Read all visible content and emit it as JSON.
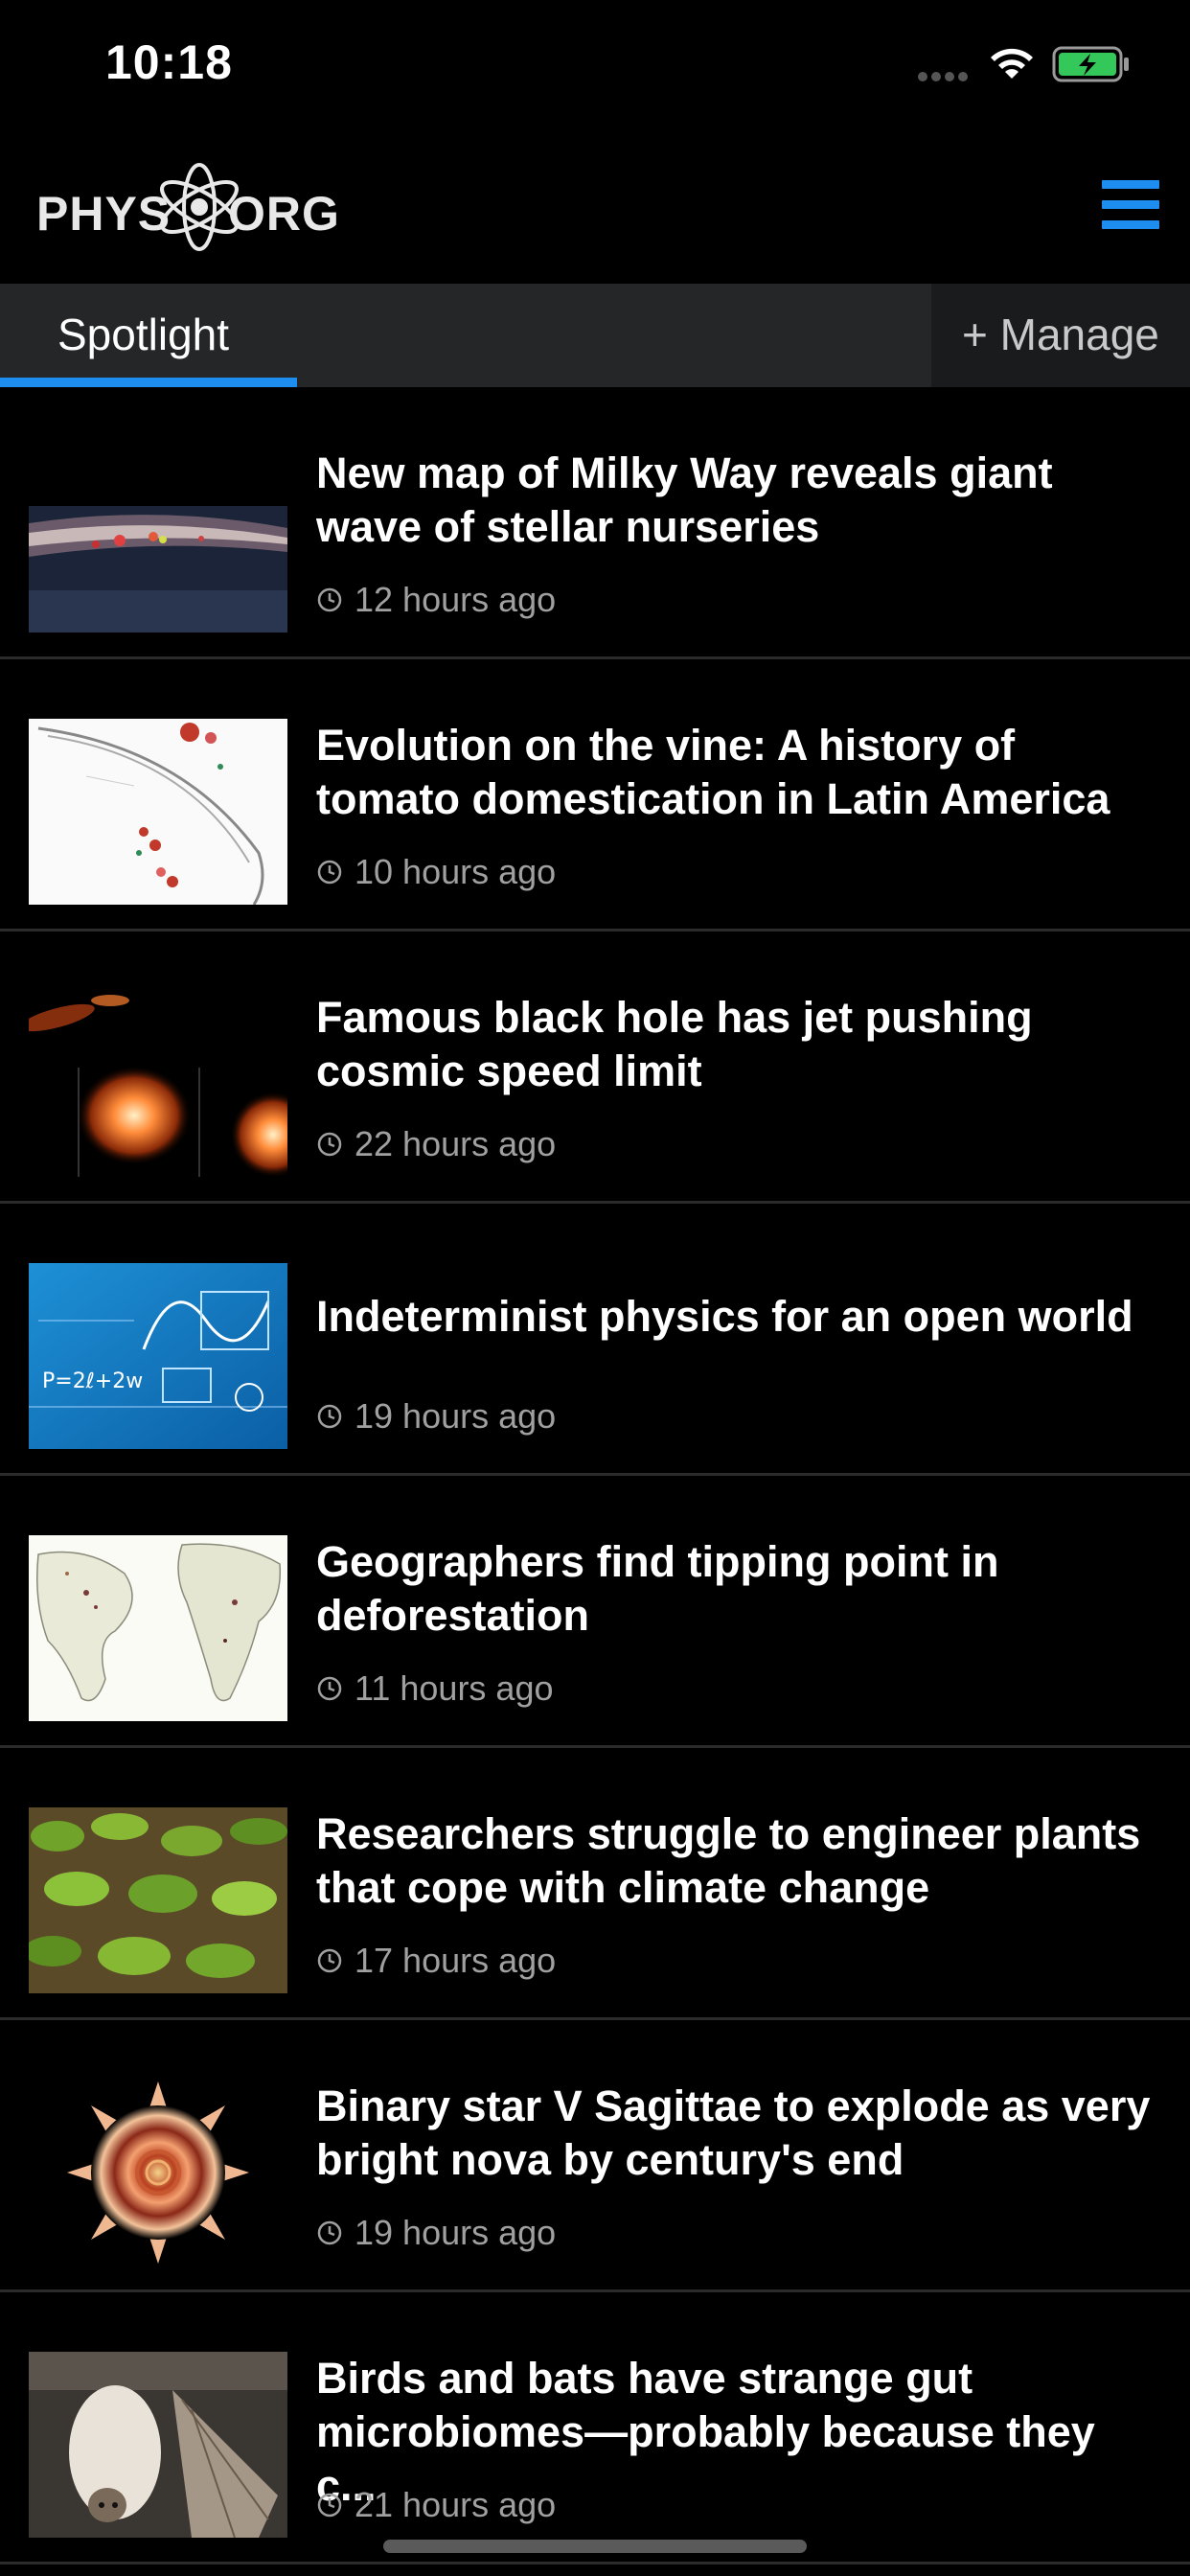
{
  "status_bar": {
    "time": "10:18"
  },
  "header": {
    "logo_left": "PHYS",
    "logo_right": "ORG",
    "accent_color": "#1d8ef0"
  },
  "tabs": {
    "spotlight": "Spotlight",
    "manage": "+ Manage"
  },
  "articles": [
    {
      "title": "New map of Milky Way reveals giant\nwave of stellar nurseries",
      "time": "12 hours ago",
      "thumbnail": "milky-way"
    },
    {
      "title": "Evolution on the vine: A history of\ntomato domestication in Latin America",
      "time": "10 hours ago",
      "thumbnail": "tomato-diagram"
    },
    {
      "title": "Famous black hole has jet pushing\ncosmic speed limit",
      "time": "22 hours ago",
      "thumbnail": "black-hole-jet"
    },
    {
      "title": "Indeterminist physics for an open world",
      "time": "19 hours ago",
      "thumbnail": "physics-formulas"
    },
    {
      "title": "Geographers find tipping point in\ndeforestation",
      "time": "11 hours ago",
      "thumbnail": "world-map"
    },
    {
      "title": "Researchers struggle to engineer plants\nthat cope with climate change",
      "time": "17 hours ago",
      "thumbnail": "plants"
    },
    {
      "title": "Binary star V Sagittae to explode as very\nbright nova by century's end",
      "time": "19 hours ago",
      "thumbnail": "nova"
    },
    {
      "title": "Birds and bats have strange gut\nmicrobiomes—probably because they c...",
      "time": "21 hours ago",
      "thumbnail": "bat"
    }
  ]
}
